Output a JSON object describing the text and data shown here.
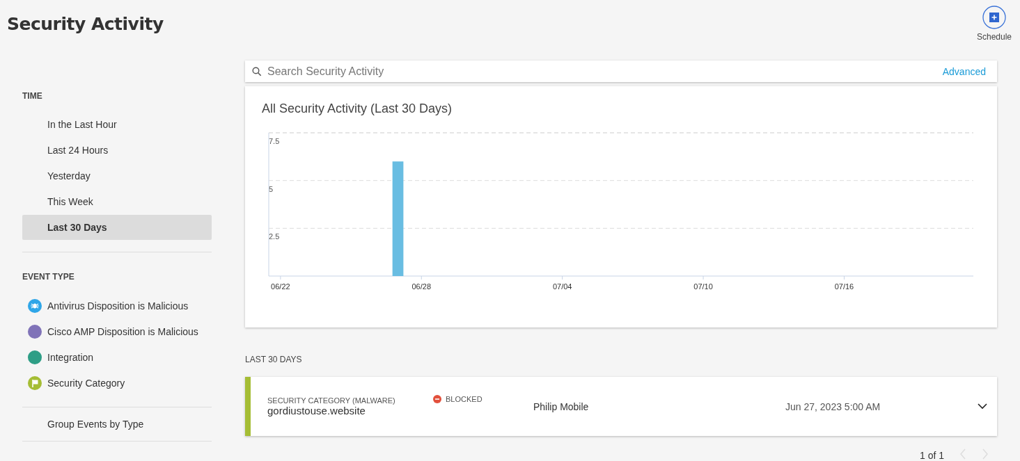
{
  "page": {
    "title": "Security Activity"
  },
  "schedule_button": {
    "label": "Schedule"
  },
  "sidebar": {
    "time": {
      "heading": "TIME",
      "items": [
        {
          "label": "In the Last Hour",
          "selected": false
        },
        {
          "label": "Last 24 Hours",
          "selected": false
        },
        {
          "label": "Yesterday",
          "selected": false
        },
        {
          "label": "This Week",
          "selected": false
        },
        {
          "label": "Last 30 Days",
          "selected": true
        }
      ]
    },
    "event_type": {
      "heading": "EVENT TYPE",
      "items": [
        {
          "label": "Antivirus Disposition is Malicious",
          "kind": "bug",
          "color": "#2fa6e8"
        },
        {
          "label": "Cisco AMP Disposition is Malicious",
          "kind": "dot",
          "color": "#8073b8"
        },
        {
          "label": "Integration",
          "kind": "dot",
          "color": "#2e9e86"
        },
        {
          "label": "Security Category",
          "kind": "flag",
          "color": "#a5bd34"
        }
      ]
    },
    "group_link": "Group Events by Type"
  },
  "search": {
    "placeholder": "Search Security Activity",
    "advanced": "Advanced"
  },
  "chart_card": {
    "chart_data": {
      "type": "bar",
      "title": "All Security Activity (Last 30 Days)",
      "categories": [
        "06/22",
        null,
        null,
        null,
        null,
        null,
        "06/28",
        null,
        null,
        null,
        null,
        null,
        "07/04",
        null,
        null,
        null,
        null,
        null,
        "07/10",
        null,
        null,
        null,
        null,
        null,
        "07/16",
        null,
        null,
        null,
        null,
        null
      ],
      "series": [
        {
          "color": "#69bde2",
          "values": [
            0,
            0,
            0,
            0,
            0,
            6,
            0,
            0,
            0,
            0,
            0,
            0,
            0,
            0,
            0,
            0,
            0,
            0,
            0,
            0,
            0,
            0,
            0,
            0,
            0,
            0,
            0,
            0,
            0,
            0
          ]
        }
      ],
      "ylim": [
        0,
        7.5
      ],
      "yticks": [
        2.5,
        5,
        7.5
      ]
    }
  },
  "events": {
    "heading": "LAST 30 DAYS",
    "rows": [
      {
        "category": "SECURITY CATEGORY (MALWARE)",
        "domain": "gordiustouse.website",
        "status": "BLOCKED",
        "identity": "Philip Mobile",
        "time": "Jun 27, 2023 5:00 AM",
        "color": "#a5bd34",
        "expanded": false
      }
    ]
  },
  "pagination": {
    "label": "1 of 1",
    "prev_disabled": true,
    "next_disabled": true
  }
}
